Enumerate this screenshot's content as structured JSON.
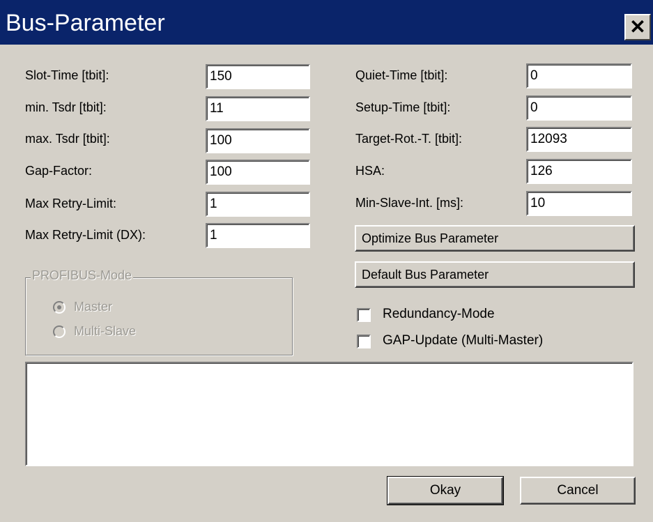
{
  "window": {
    "title": "Bus-Parameter",
    "close_glyph": "✕"
  },
  "left_fields": [
    {
      "label": "Slot-Time [tbit]:",
      "value": "150"
    },
    {
      "label": "min. Tsdr [tbit]:",
      "value": "11"
    },
    {
      "label": "max. Tsdr [tbit]:",
      "value": "100"
    },
    {
      "label": "Gap-Factor:",
      "value": "100"
    },
    {
      "label": "Max Retry-Limit:",
      "value": "1"
    },
    {
      "label": "Max Retry-Limit (DX):",
      "value": "1"
    }
  ],
  "right_fields": [
    {
      "label": "Quiet-Time [tbit]:",
      "value": "0"
    },
    {
      "label": "Setup-Time [tbit]:",
      "value": "0"
    },
    {
      "label": "Target-Rot.-T. [tbit]:",
      "value": "12093"
    },
    {
      "label": "HSA:",
      "value": "126"
    },
    {
      "label": "Min-Slave-Int. [ms]:",
      "value": "10"
    }
  ],
  "buttons": {
    "optimize": "Optimize Bus Parameter",
    "default": "Default Bus Parameter",
    "okay": "Okay",
    "cancel": "Cancel"
  },
  "profibus_mode": {
    "legend": "PROFIBUS-Mode",
    "options": [
      {
        "label": "Master",
        "selected": true
      },
      {
        "label": "Multi-Slave",
        "selected": false
      }
    ],
    "disabled": true
  },
  "checkboxes": [
    {
      "label": "Redundancy-Mode",
      "checked": false
    },
    {
      "label": "GAP-Update (Multi-Master)",
      "checked": false
    }
  ],
  "message_area": {
    "value": ""
  },
  "colors": {
    "titlebar": "#0a246a",
    "face": "#d4d0c8",
    "disabled_text": "#9c9a94"
  },
  "icons": {
    "close": "close-icon",
    "radio": "radio-button-icon",
    "checkbox": "checkbox-icon"
  }
}
